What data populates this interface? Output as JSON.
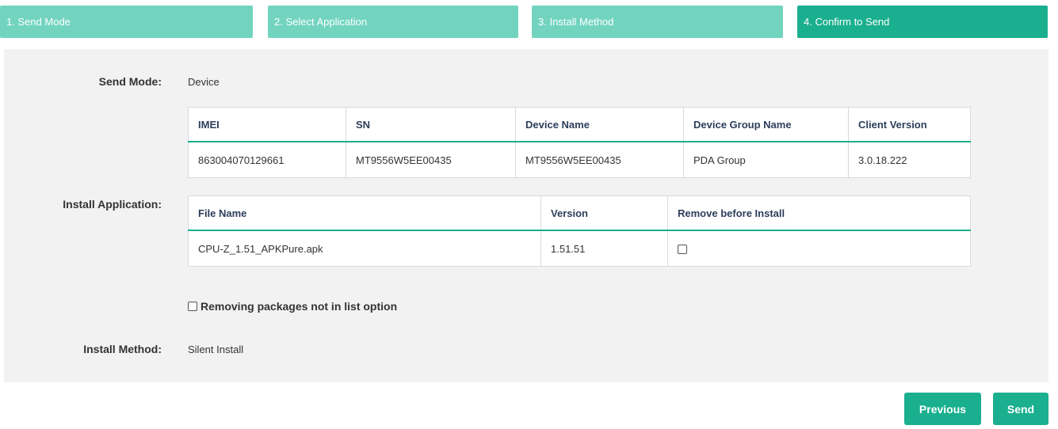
{
  "steps": [
    {
      "label": "1. Send Mode"
    },
    {
      "label": "2. Select Application"
    },
    {
      "label": "3. Install Method"
    },
    {
      "label": "4. Confirm to Send"
    }
  ],
  "send_mode": {
    "label": "Send Mode:",
    "value": "Device"
  },
  "device_table": {
    "headers": [
      "IMEI",
      "SN",
      "Device Name",
      "Device Group Name",
      "Client Version"
    ],
    "rows": [
      [
        "863004070129661",
        "MT9556W5EE00435",
        "MT9556W5EE00435",
        "PDA Group",
        "3.0.18.222"
      ]
    ]
  },
  "install_application": {
    "label": "Install Application:"
  },
  "app_table": {
    "headers": [
      "File Name",
      "Version",
      "Remove before Install"
    ],
    "rows": [
      [
        "CPU-Z_1.51_APKPure.apk",
        "1.51.51"
      ]
    ]
  },
  "remove_option": {
    "label": "Removing packages not in list option"
  },
  "install_method": {
    "label": "Install Method:",
    "value": "Silent Install"
  },
  "buttons": {
    "previous": "Previous",
    "send": "Send"
  },
  "colors": {
    "step": "#72d4bf",
    "step_active": "#1aaf8e",
    "button": "#1aaf8e"
  }
}
